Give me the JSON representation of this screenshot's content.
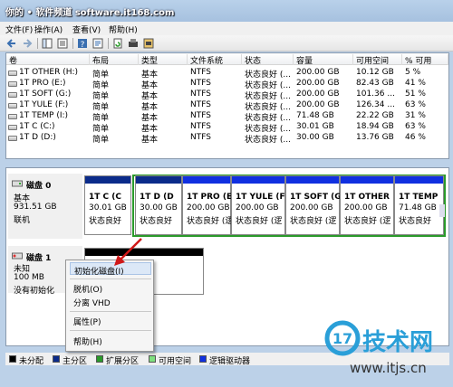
{
  "watermark_top": "你的 • 软件频道 software.it168.com",
  "menu": [
    "文件(F)",
    "操作(A)",
    "查看(V)",
    "帮助(H)"
  ],
  "columns": [
    "卷",
    "布局",
    "类型",
    "文件系统",
    "状态",
    "容量",
    "可用空间",
    "% 可用"
  ],
  "volumes": [
    [
      "1T OTHER (H:)",
      "简单",
      "基本",
      "NTFS",
      "状态良好 (...",
      "200.00 GB",
      "10.12 GB",
      "5 %"
    ],
    [
      "1T PRO (E:)",
      "简单",
      "基本",
      "NTFS",
      "状态良好 (...",
      "200.00 GB",
      "82.43 GB",
      "41 %"
    ],
    [
      "1T SOFT (G:)",
      "简单",
      "基本",
      "NTFS",
      "状态良好 (...",
      "200.00 GB",
      "101.36 ...",
      "51 %"
    ],
    [
      "1T YULE (F:)",
      "简单",
      "基本",
      "NTFS",
      "状态良好 (...",
      "200.00 GB",
      "126.34 ...",
      "63 %"
    ],
    [
      "1T TEMP (I:)",
      "简单",
      "基本",
      "NTFS",
      "状态良好 (...",
      "71.48 GB",
      "22.22 GB",
      "31 %"
    ],
    [
      "1T C (C:)",
      "简单",
      "基本",
      "NTFS",
      "状态良好 (...",
      "30.01 GB",
      "18.94 GB",
      "63 %"
    ],
    [
      "1T D (D:)",
      "简单",
      "基本",
      "NTFS",
      "状态良好 (...",
      "30.00 GB",
      "13.76 GB",
      "46 %"
    ]
  ],
  "disk0": {
    "name": "磁盘 0",
    "type": "基本",
    "size": "931.51 GB",
    "status": "联机",
    "partitions": [
      {
        "name": "1T C (C",
        "size": "30.01 GB",
        "status": "状态良好"
      },
      {
        "name": "1T D (D",
        "size": "30.00 GB",
        "status": "状态良好"
      },
      {
        "name": "1T PRO (E:",
        "size": "200.00 GB",
        "status": "状态良好 (逻"
      },
      {
        "name": "1T YULE (F:",
        "size": "200.00 GB",
        "status": "状态良好 (逻"
      },
      {
        "name": "1T SOFT (G",
        "size": "200.00 GB",
        "status": "状态良好 (逻"
      },
      {
        "name": "1T OTHER",
        "size": "200.00 GB",
        "status": "状态良好 (逻"
      },
      {
        "name": "1T TEMP",
        "size": "71.48 GB",
        "status": "状态良好"
      }
    ]
  },
  "disk1": {
    "name": "磁盘 1",
    "type": "未知",
    "size": "100 MB",
    "status": "没有初始化"
  },
  "context_menu": [
    "初始化磁盘(I)",
    "脱机(O)",
    "分离 VHD",
    "属性(P)",
    "帮助(H)"
  ],
  "legend": [
    {
      "label": "未分配",
      "color": "#000000"
    },
    {
      "label": "主分区",
      "color": "#0b2b8a"
    },
    {
      "label": "扩展分区",
      "color": "#2a9a2a"
    },
    {
      "label": "可用空间",
      "color": "#7fe07f"
    },
    {
      "label": "逻辑驱动器",
      "color": "#1030e0"
    }
  ],
  "watermark_brand": "技术网",
  "watermark_url": "www.itjs.cn"
}
